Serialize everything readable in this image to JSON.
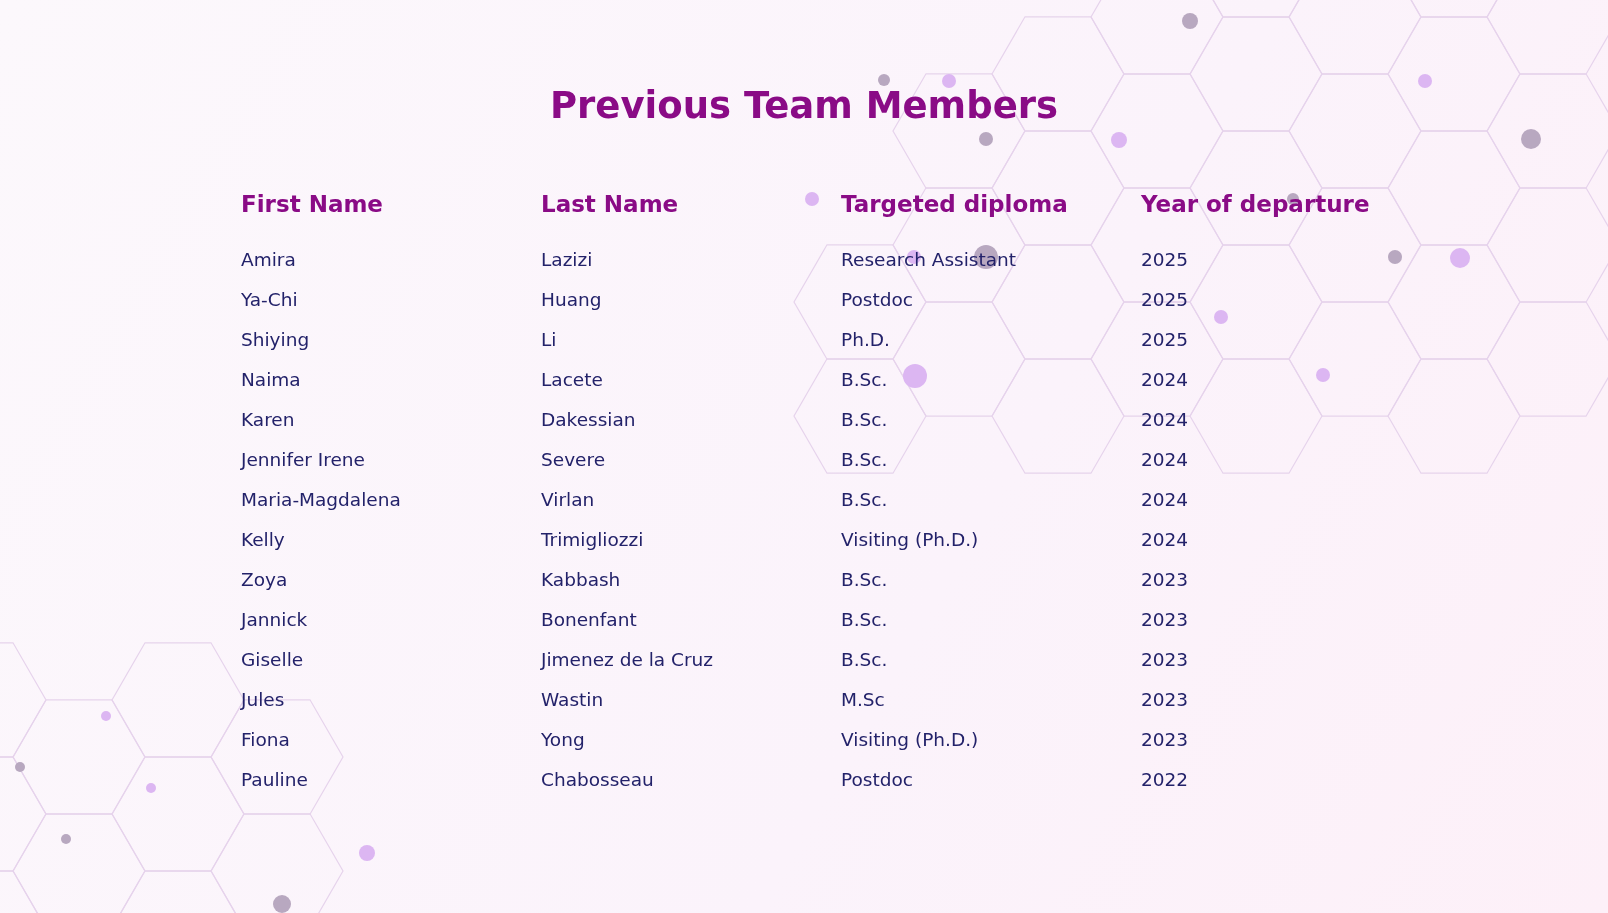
{
  "title": "Previous Team Members",
  "table": {
    "columns": [
      "First Name",
      "Last Name",
      "Targeted diploma",
      "Year of departure"
    ],
    "rows": [
      [
        "Amira",
        "Lazizi",
        "Research Assistant",
        "2025"
      ],
      [
        "Ya-Chi",
        "Huang",
        "Postdoc",
        "2025"
      ],
      [
        "Shiying",
        "Li",
        "Ph.D.",
        "2025"
      ],
      [
        "Naima",
        "Lacete",
        "B.Sc.",
        "2024"
      ],
      [
        "Karen",
        "Dakessian",
        "B.Sc.",
        "2024"
      ],
      [
        "Jennifer Irene",
        "Severe",
        "B.Sc.",
        "2024"
      ],
      [
        "Maria-Magdalena",
        "Virlan",
        "B.Sc.",
        "2024"
      ],
      [
        "Kelly",
        "Trimigliozzi",
        "Visiting (Ph.D.)",
        "2024"
      ],
      [
        "Zoya",
        "Kabbash",
        "B.Sc.",
        "2023"
      ],
      [
        "Jannick",
        "Bonenfant",
        "B.Sc.",
        "2023"
      ],
      [
        "Giselle",
        "Jimenez de la Cruz",
        "B.Sc.",
        "2023"
      ],
      [
        "Jules",
        "Wastin",
        "M.Sc",
        "2023"
      ],
      [
        "Fiona",
        "Yong",
        "Visiting (Ph.D.)",
        "2023"
      ],
      [
        "Pauline",
        "Chabosseau",
        "Postdoc",
        "2022"
      ]
    ]
  }
}
